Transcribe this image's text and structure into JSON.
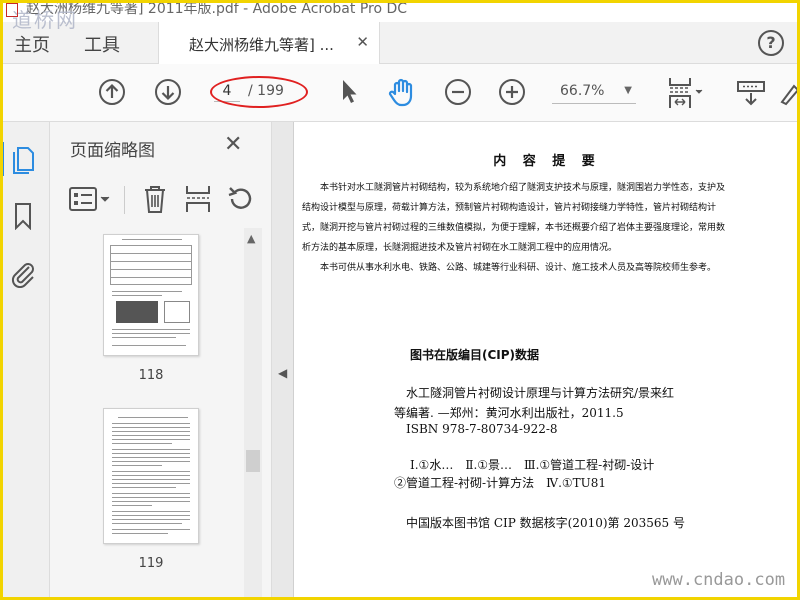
{
  "window": {
    "title": "赵大洲杨维九等著] 2011年版.pdf - Adobe Acrobat Pro DC"
  },
  "watermarks": {
    "top_left": "道桥网",
    "bottom_right": "www.cndao.com"
  },
  "tabs": {
    "home": "主页",
    "tools": "工具",
    "document": "赵大洲杨维九等著] ..."
  },
  "toolbar": {
    "current_page": "4",
    "total_pages": "/ 199",
    "zoom": "66.7%"
  },
  "panel": {
    "title": "页面缩略图",
    "thumbnails": [
      {
        "page_label": "118"
      },
      {
        "page_label": "119"
      }
    ]
  },
  "document": {
    "heading": "内 容 提 要",
    "intro_lines": [
      "　　本书针对水工隧洞管片衬砌结构，较为系统地介绍了隧洞支护技术与原理，隧洞围岩力学性态，支护及",
      "结构设计模型与原理，荷载计算方法，预制管片衬砌构造设计，管片衬砌接缝力学特性，管片衬砌结构计",
      "式，隧洞开挖与管片衬砌过程的三维数值模拟，为便于理解，本书还概要介绍了岩体主要强度理论，常用数",
      "析方法的基本原理，长隧洞掘进技术及管片衬砌在水工隧洞工程中的应用情况。",
      "　　本书可供从事水利水电、铁路、公路、城建等行业科研、设计、施工技术人员及高等院校师生参考。"
    ],
    "cip_title": "图书在版编目(CIP)数据",
    "cip_lines": [
      "水工隧洞管片衬砌设计原理与计算方法研究/景来红",
      "等编著. —郑州：黄河水利出版社，2011.5",
      "ISBN 978-7-80734-922-8",
      "Ⅰ.①水…　Ⅱ.①景…　Ⅲ.①管道工程-衬砌-设计",
      "②管道工程-衬砌-计算方法　Ⅳ.①TU81",
      "中国版本图书馆 CIP 数据核字(2010)第 203565 号"
    ]
  },
  "colors": {
    "accent_blue": "#2d8ce0",
    "highlight_red": "#e02020",
    "frame_yellow": "#f2d400"
  }
}
